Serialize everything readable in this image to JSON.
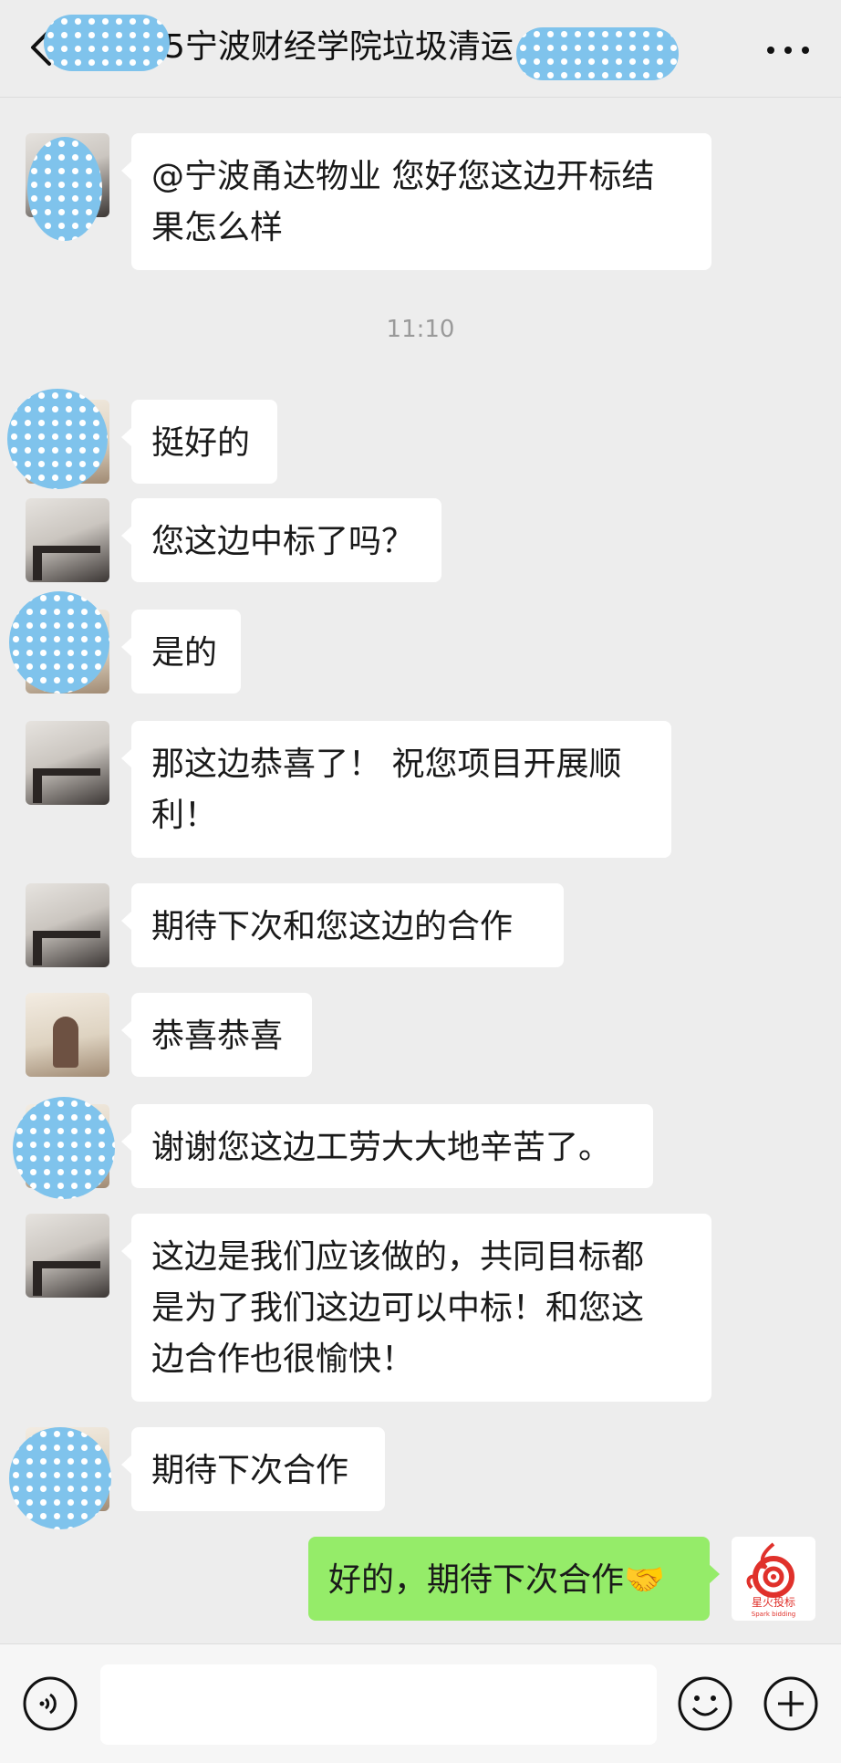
{
  "header": {
    "title": "5宁波财经学院垃圾清运",
    "back_icon": "chevron-left-icon",
    "more_icon": "ellipsis-icon"
  },
  "messages": [
    {
      "text": "@宁波甬达物业 您好您这边开标结\n果怎么样",
      "avatar": "photo-window"
    },
    {
      "time": "11:10"
    },
    {
      "text": "挺好的",
      "avatar": "redacted"
    },
    {
      "text": "您这边中标了吗？",
      "avatar": "photo-window"
    },
    {
      "text": "是的",
      "avatar": "redacted"
    },
    {
      "text": "那这边恭喜了！ 祝您项目开展顺\n利！",
      "avatar": "photo-window"
    },
    {
      "text": "期待下次和您这边的合作",
      "avatar": "photo-window"
    },
    {
      "text": "恭喜恭喜",
      "avatar": "photo-girl"
    },
    {
      "text": "谢谢您这边工劳大大地辛苦了。",
      "avatar": "redacted"
    },
    {
      "text": "这边是我们应该做的，共同目标都\n是为了我们这边可以中标！和您这\n边合作也很愉快！",
      "avatar": "photo-window"
    },
    {
      "text": "期待下次合作",
      "avatar": "redacted"
    },
    {
      "text": "好的，期待下次合作🤝",
      "avatar": "spark-logo",
      "self": true
    }
  ],
  "self_avatar": {
    "logo_text": "星火投标",
    "logo_subtext": "Spark bidding",
    "brand_color": "#e0312b"
  },
  "input_bar": {
    "voice_icon": "voice-icon",
    "emoji_icon": "emoji-icon",
    "plus_icon": "plus-icon"
  },
  "colors": {
    "background": "#ededed",
    "bubble_other": "#ffffff",
    "bubble_self": "#95ec69",
    "redaction": "#7fc3ec"
  }
}
